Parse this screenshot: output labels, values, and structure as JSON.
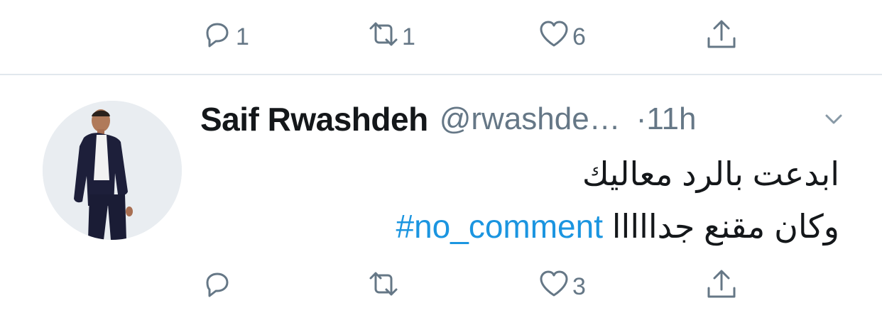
{
  "previous_tweet": {
    "actions": {
      "reply_count": "1",
      "retweet_count": "1",
      "like_count": "6",
      "reply_icon": "reply-icon",
      "retweet_icon": "retweet-icon",
      "like_icon": "heart-icon",
      "share_icon": "share-icon"
    }
  },
  "tweet": {
    "author_name": "Saif Rwashdeh",
    "author_handle": "@rwashde…",
    "separator": "·",
    "time": "11h",
    "text_line_1": "ابدعت بالرد معاليك",
    "text_line_2": "وكان مقنع جدااااا",
    "hashtag": "#no_comment",
    "actions": {
      "reply_count": "",
      "retweet_count": "",
      "like_count": "3"
    }
  },
  "colors": {
    "text": "#14171a",
    "secondary": "#657786",
    "hashtag": "#1b95e0",
    "divider": "#e1e8ed"
  }
}
